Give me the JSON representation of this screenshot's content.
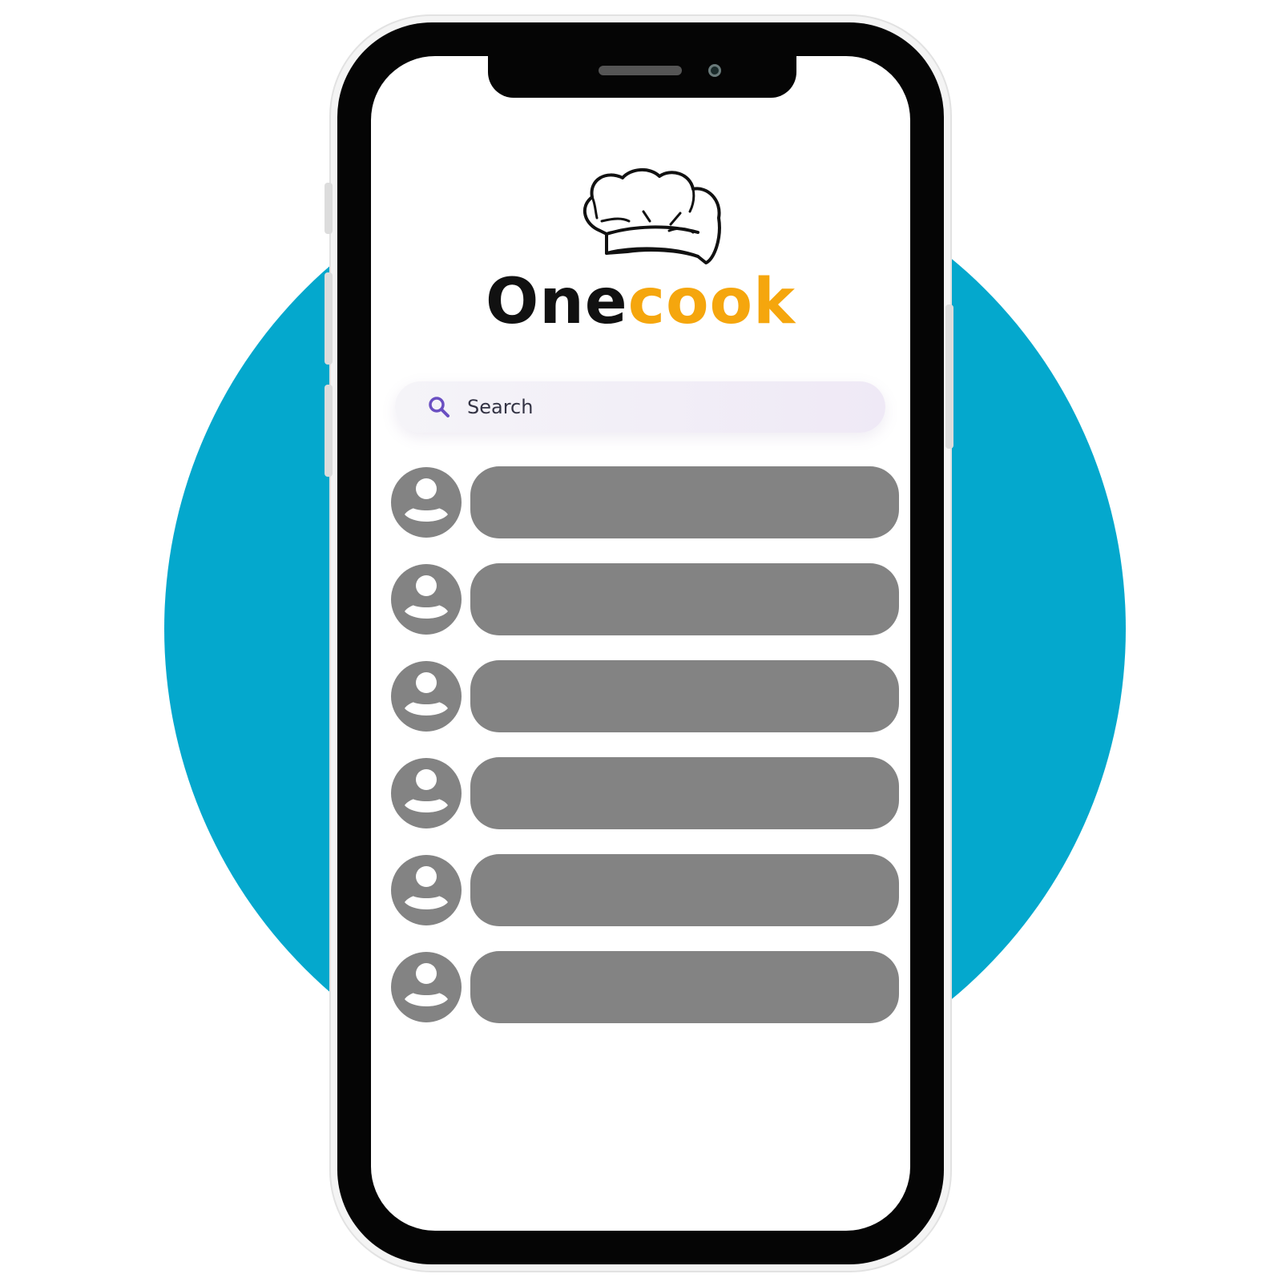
{
  "app": {
    "brand_part1": "One",
    "brand_part2": "cook",
    "logo_icon": "chef-hat-icon"
  },
  "search": {
    "value": "Search",
    "icon": "search-icon"
  },
  "list": {
    "items": [
      {
        "avatar_icon": "user-avatar-icon",
        "label": ""
      },
      {
        "avatar_icon": "user-avatar-icon",
        "label": ""
      },
      {
        "avatar_icon": "user-avatar-icon",
        "label": ""
      },
      {
        "avatar_icon": "user-avatar-icon",
        "label": ""
      },
      {
        "avatar_icon": "user-avatar-icon",
        "label": ""
      },
      {
        "avatar_icon": "user-avatar-icon",
        "label": ""
      }
    ]
  },
  "colors": {
    "background_circle": "#04a8cd",
    "brand_dark": "#111111",
    "brand_accent": "#f5a60d",
    "placeholder": "#838383",
    "search_icon": "#6a4fc2"
  }
}
